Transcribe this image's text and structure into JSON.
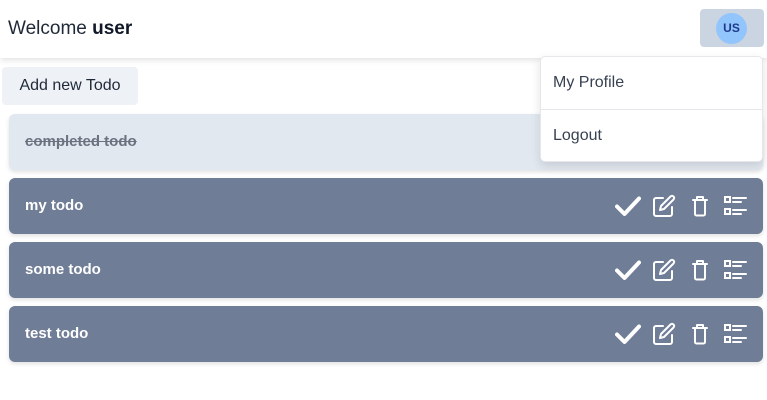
{
  "header": {
    "welcome_prefix": "Welcome",
    "username": "user",
    "avatar_initials": "US"
  },
  "toolbar": {
    "add_label": "Add new Todo"
  },
  "todos": [
    {
      "text": "completed todo",
      "completed": true
    },
    {
      "text": "my todo",
      "completed": false
    },
    {
      "text": "some todo",
      "completed": false
    },
    {
      "text": "test todo",
      "completed": false
    }
  ],
  "user_menu": {
    "items": [
      {
        "label": "My Profile"
      },
      {
        "label": "Logout"
      }
    ]
  },
  "icons": {
    "complete": "check-icon",
    "edit": "edit-icon",
    "delete": "trash-icon",
    "details": "checklist-icon"
  },
  "colors": {
    "todo_active_bg": "#707d96",
    "todo_completed_bg": "#e2e8f0",
    "avatar_bg": "#93c5fd",
    "avatar_button_bg": "#cbd5e1"
  }
}
